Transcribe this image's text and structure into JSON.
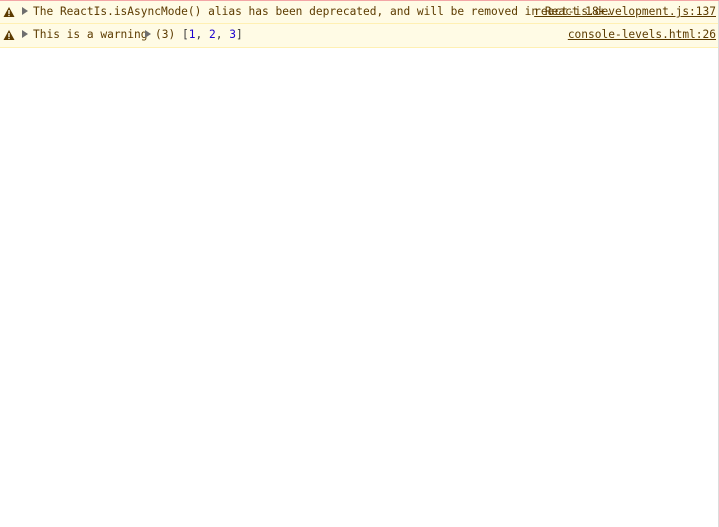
{
  "console": {
    "messages": [
      {
        "level": "warning",
        "text": "The ReactIs.isAsyncMode() alias has been deprecated, and will be removed in React 18+.",
        "source": "react-is.development.js:137"
      },
      {
        "level": "warning",
        "text": "This is a warning",
        "array_summary": "(3)",
        "array_open": "[",
        "array_items": [
          "1",
          "2",
          "3"
        ],
        "array_sep": ", ",
        "array_close": "]",
        "source": "console-levels.html:26"
      }
    ]
  },
  "colors": {
    "warning_background": "#fffbe5",
    "warning_border": "#fff0b3",
    "warning_text": "#5c3b00",
    "error_accent": "#f3a6a6",
    "number": "#1c00cf"
  },
  "icons": {
    "warning": "warning-triangle-icon",
    "expand": "disclosure-triangle-icon"
  }
}
